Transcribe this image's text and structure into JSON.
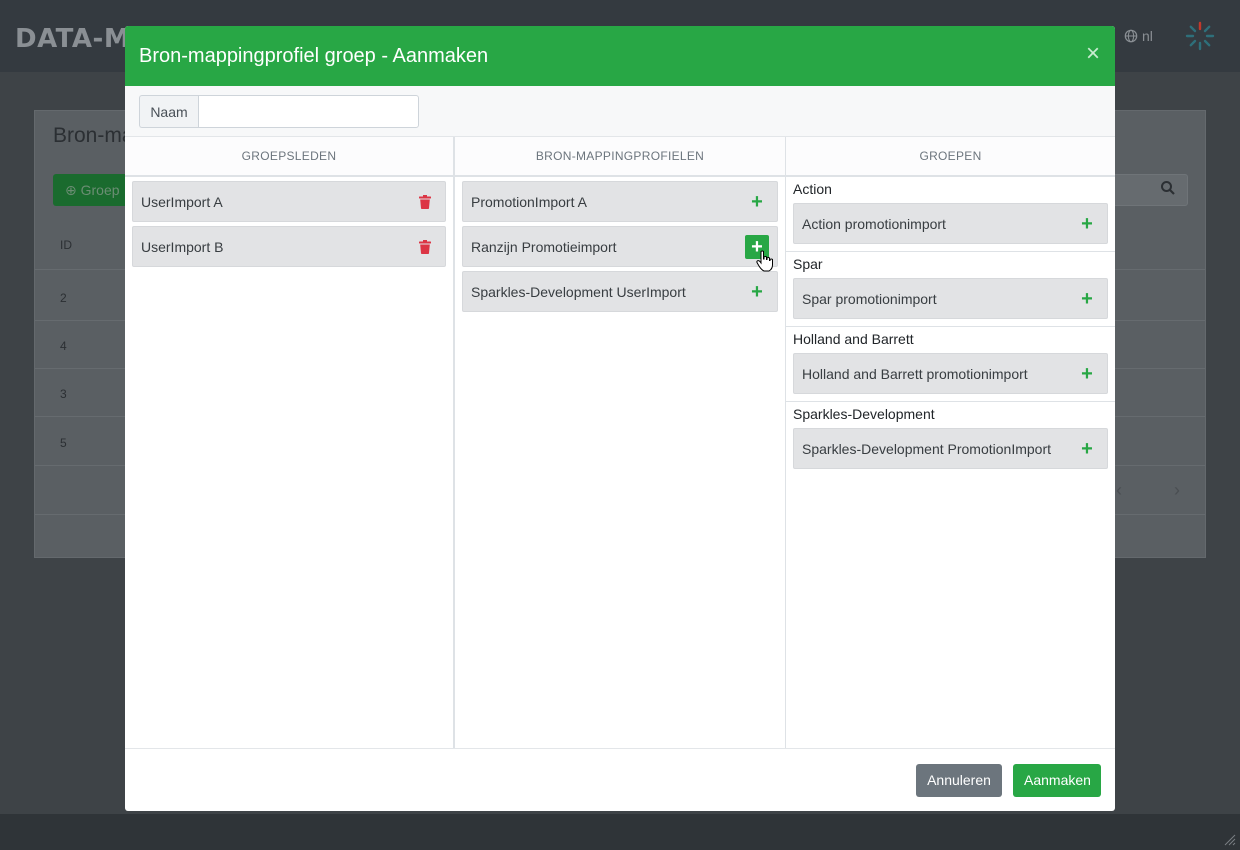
{
  "app": {
    "brand": "DATA-MA",
    "language": "nl"
  },
  "background": {
    "card_title": "Bron-ma",
    "add_button_label": "Groep",
    "id_header": "ID",
    "rows": [
      "2",
      "4",
      "3",
      "5"
    ]
  },
  "modal": {
    "title": "Bron-mappingprofiel groep - Aanmaken",
    "close_label": "×",
    "name_label": "Naam",
    "name_value": "",
    "name_placeholder": ""
  },
  "columns": {
    "members": {
      "header": "GROEPSLEDEN",
      "items": [
        {
          "label": "UserImport A"
        },
        {
          "label": "UserImport B"
        }
      ]
    },
    "profiles": {
      "header": "BRON-MAPPINGPROFIELEN",
      "items": [
        {
          "label": "PromotionImport A"
        },
        {
          "label": "Ranzijn Promotieimport"
        },
        {
          "label": "Sparkles-Development UserImport"
        }
      ]
    },
    "groups": {
      "header": "GROEPEN",
      "items": [
        {
          "title": "Action",
          "item": "Action promotionimport"
        },
        {
          "title": "Spar",
          "item": "Spar promotionimport"
        },
        {
          "title": "Holland and Barrett",
          "item": "Holland and Barrett promotionimport"
        },
        {
          "title": "Sparkles-Development",
          "item": "Sparkles-Development PromotionImport"
        }
      ]
    }
  },
  "footer": {
    "cancel_label": "Annuleren",
    "create_label": "Aanmaken"
  },
  "icons": {
    "add": "plus-icon",
    "delete": "trash-icon",
    "close": "close-icon",
    "language": "globe-icon"
  },
  "colors": {
    "primary_green": "#28a745",
    "danger_red": "#dc3545",
    "secondary_gray": "#6c757d"
  }
}
